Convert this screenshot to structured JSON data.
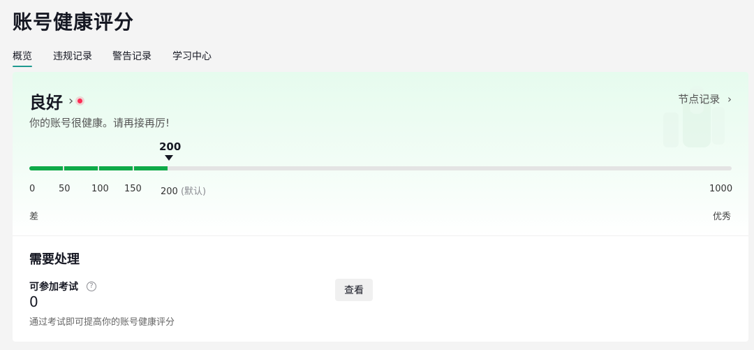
{
  "page": {
    "title": "账号健康评分"
  },
  "tabs": [
    {
      "label": "概览",
      "active": true
    },
    {
      "label": "违规记录",
      "active": false
    },
    {
      "label": "警告记录",
      "active": false
    },
    {
      "label": "学习中心",
      "active": false
    }
  ],
  "score": {
    "status": "良好",
    "description": "你的账号很健康。请再接再厉!",
    "node_record_label": "节点记录",
    "current_value": "200",
    "max_value": 1000,
    "accent_color": "#0eaa48",
    "ticks": [
      {
        "value": "0",
        "suffix": ""
      },
      {
        "value": "50",
        "suffix": ""
      },
      {
        "value": "100",
        "suffix": ""
      },
      {
        "value": "150",
        "suffix": ""
      },
      {
        "value": "200",
        "suffix": "(默认)"
      },
      {
        "value": "1000",
        "suffix": ""
      }
    ],
    "low_label": "差",
    "high_label": "优秀"
  },
  "todo": {
    "title": "需要处理",
    "exam": {
      "label": "可参加考试",
      "count": "0",
      "description": "通过考试即可提高你的账号健康评分",
      "button_label": "查看"
    }
  }
}
